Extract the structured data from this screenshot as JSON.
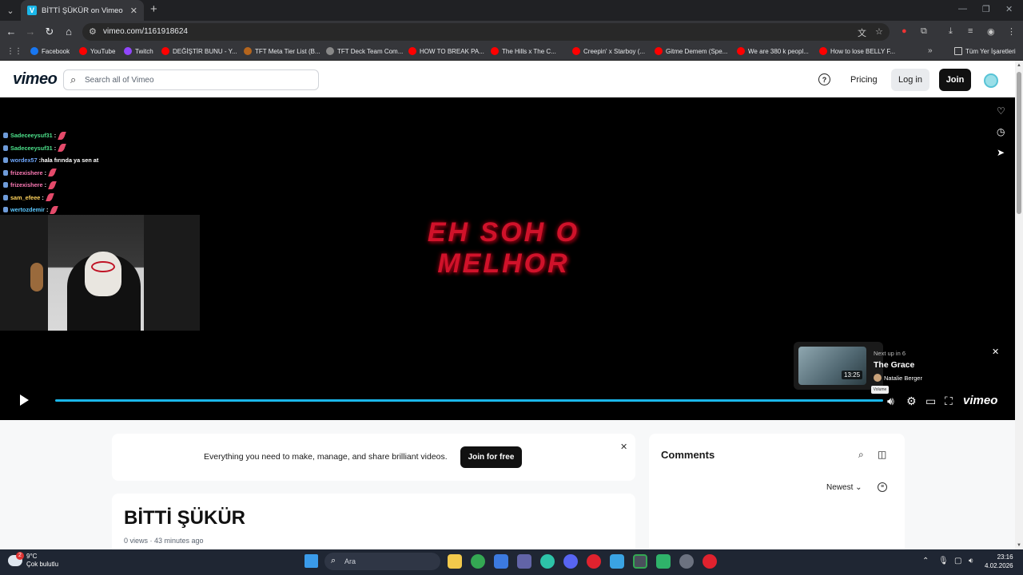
{
  "browser": {
    "tab_title": "BİTTİ ŞÜKÜR on Vimeo",
    "url": "vimeo.com/1161918624",
    "bookmarks": [
      {
        "label": "Facebook",
        "color": "#1877f2"
      },
      {
        "label": "YouTube",
        "color": "#ff0000"
      },
      {
        "label": "Twitch",
        "color": "#9146ff"
      },
      {
        "label": "DEĞİŞTİR BUNU - Y...",
        "color": "#ff0000"
      },
      {
        "label": "TFT Meta Tier List (B...",
        "color": "#b5651d"
      },
      {
        "label": "TFT Deck Team Com...",
        "color": "#888888"
      },
      {
        "label": "HOW TO BREAK PA...",
        "color": "#ff0000"
      },
      {
        "label": "The Hills x The C...",
        "color": "#ff0000"
      },
      {
        "label": "Creepin' x Starboy (...",
        "color": "#ff0000"
      },
      {
        "label": "Gitme Demem (Spe...",
        "color": "#ff0000"
      },
      {
        "label": "We are 380 k peopl...",
        "color": "#ff0000"
      },
      {
        "label": "How to lose BELLY F...",
        "color": "#ff0000"
      }
    ],
    "all_bookmarks": "Tüm Yer İşaretleri"
  },
  "header": {
    "logo": "vimeo",
    "search_placeholder": "Search all of Vimeo",
    "pricing": "Pricing",
    "login": "Log in",
    "join": "Join"
  },
  "player": {
    "overlay_title": "EH SOH O MELHOR",
    "chat": [
      {
        "user": "Sadeceeysuf31",
        "msg": "",
        "color": "#4ce08a"
      },
      {
        "user": "Sadeceeysuf31",
        "msg": "",
        "color": "#4ce08a"
      },
      {
        "user": "wordex57",
        "msg": "hala fırında ya sen at",
        "color": "#6fa8ff"
      },
      {
        "user": "frizexishere",
        "msg": "",
        "color": "#ff7ab6"
      },
      {
        "user": "frizexishere",
        "msg": "",
        "color": "#ff7ab6"
      },
      {
        "user": "sam_efeee",
        "msg": "",
        "color": "#ffd35c"
      },
      {
        "user": "wertozdemir",
        "msg": "",
        "color": "#5cc8ff"
      }
    ],
    "up_next": {
      "label": "Next up in 6",
      "title": "The Grace",
      "author": "Natalie Berger",
      "duration": "13:25"
    },
    "volume_tooltip": "Volume",
    "progress": 1.0
  },
  "promo": {
    "text": "Everything you need to make, manage, and share brilliant videos.",
    "button": "Join for free"
  },
  "video": {
    "title": "BİTTİ ŞÜKÜR",
    "meta": "0 views · 43 minutes ago"
  },
  "comments": {
    "heading": "Comments",
    "sort": "Newest"
  },
  "taskbar": {
    "temp": "9°C",
    "weather": "Çok bulutlu",
    "weather_badge": "2",
    "search": "Ara",
    "time": "23:16",
    "date": "4.02.2026"
  }
}
